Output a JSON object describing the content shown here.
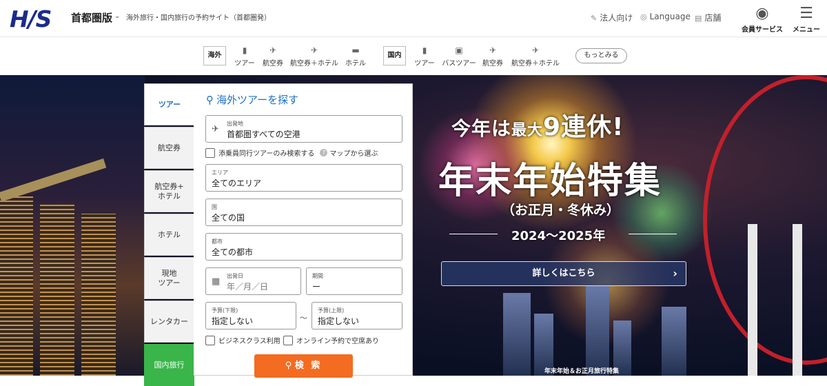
{
  "header": {
    "logo": "H/S",
    "edition": "首都圏版",
    "site_desc": "海外旅行・国内旅行の予約サイト（首都圏発）",
    "links": {
      "corporate": "法人向け",
      "language": "Language",
      "stores": "店舗"
    },
    "member_label": "会員サービス",
    "menu_label": "メニュー"
  },
  "nav": {
    "overseas_tag": "海外",
    "overseas_items": [
      "ツアー",
      "航空券",
      "航空券＋ホテル",
      "ホテル"
    ],
    "domestic_tag": "国内",
    "domestic_items": [
      "ツアー",
      "バスツアー",
      "航空券",
      "航空券＋ホテル"
    ],
    "more_label": "もっとみる"
  },
  "tabs": [
    "ツアー",
    "航空券",
    "航空券+\nホテル",
    "ホテル",
    "現地\nツアー",
    "レンタカー",
    "国内旅行"
  ],
  "search": {
    "title": "海外ツアーを探す",
    "departure": {
      "label": "出発地",
      "value": "首都圏すべての空港"
    },
    "escort_only": "添乗員同行ツアーのみ検索する",
    "map_select": "マップから選ぶ",
    "area": {
      "label": "エリア",
      "value": "全てのエリア"
    },
    "country": {
      "label": "国",
      "value": "全ての国"
    },
    "city": {
      "label": "都市",
      "value": "全ての都市"
    },
    "date": {
      "label": "出発日",
      "placeholder": "年／月／日"
    },
    "duration": {
      "label": "期間",
      "value": "ー"
    },
    "budget_min": {
      "label": "予算(下限)",
      "value": "指定しない"
    },
    "budget_max": {
      "label": "予算(上限)",
      "value": "指定しない"
    },
    "tilde": "～",
    "business_class": "ビジネスクラス利用",
    "online_available": "オンライン予約で空席あり",
    "search_button": "検 索"
  },
  "promo": {
    "line1_a": "今年は",
    "line1_b": "最大",
    "line1_c": "9連休!",
    "title": "年末年始特集",
    "subtitle": "（お正月・冬休み）",
    "years": "2024～2025年",
    "cta": "詳しくはこちら",
    "caption": "年末年始＆お正月旅行特集"
  },
  "colors": {
    "brand": "#1a2c8c",
    "accent_blue": "#1e6fc4",
    "search_orange": "#f36c21",
    "domestic_green": "#3ab54a"
  }
}
